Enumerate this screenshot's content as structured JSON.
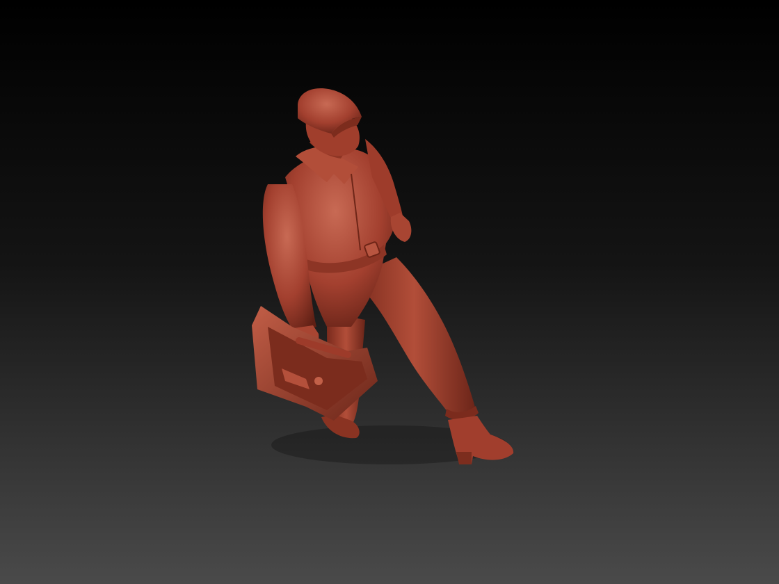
{
  "scene": {
    "background_top": "#000000",
    "background_mid": "#141414",
    "background_bottom": "#4a4a4a",
    "model_color": "#a3402f",
    "model_shadow": "#5e1f14",
    "model_highlight": "#c86a54",
    "model_name": "sculpted-worker-figure-with-toolbox"
  }
}
